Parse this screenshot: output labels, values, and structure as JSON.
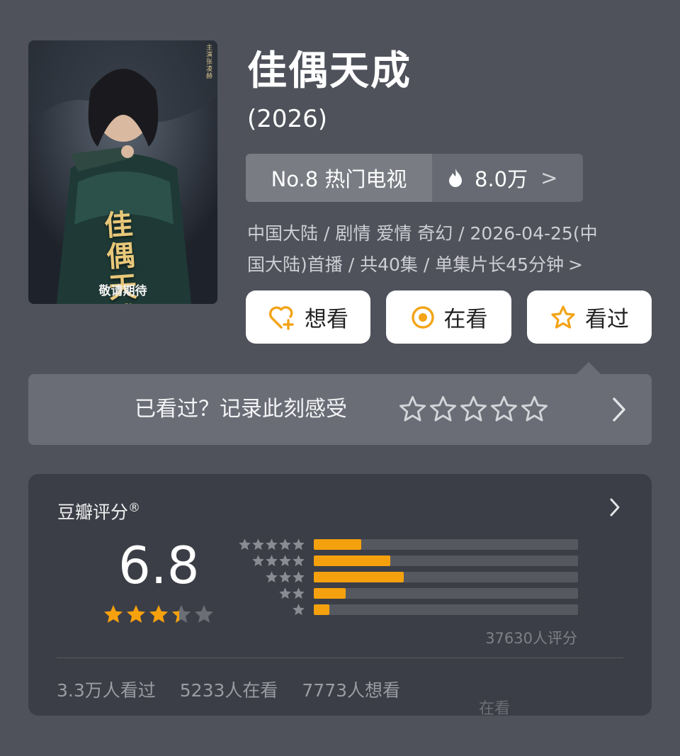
{
  "poster": {
    "calligraphy_title": "佳偶天成",
    "tagline": "敬请期待",
    "cast": "主演 张凌赫"
  },
  "header": {
    "title": "佳偶天成",
    "year": "(2026)"
  },
  "rank": {
    "label": "No.8 热门电视",
    "heat": "8.0万",
    "chevron": ">"
  },
  "meta": {
    "line1": "中国大陆 / 剧情 爱情 奇幻 / 2026-04-25(中",
    "line2": "国大陆)首播 / 共40集 / 单集片长45分钟",
    "chevron": ">"
  },
  "actions": {
    "want": {
      "label": "想看",
      "icon": "heart-plus-icon"
    },
    "watching": {
      "label": "在看",
      "icon": "target-icon"
    },
    "watched": {
      "label": "看过",
      "icon": "star-outline-icon"
    }
  },
  "prompt": {
    "text": "已看过？记录此刻感受",
    "star_count": 5
  },
  "rating": {
    "title": "豆瓣评分",
    "mark": "®",
    "score": "6.8",
    "stars_value": 3.4,
    "distribution": [
      {
        "stars": 5,
        "fraction": 0.18
      },
      {
        "stars": 4,
        "fraction": 0.29
      },
      {
        "stars": 3,
        "fraction": 0.34
      },
      {
        "stars": 2,
        "fraction": 0.12
      },
      {
        "stars": 1,
        "fraction": 0.06
      }
    ],
    "count_label": "37630人评分"
  },
  "stats": {
    "watched": "3.3万人看过",
    "watching": "5233人在看",
    "want": "7773人想看"
  },
  "watermark": "在看",
  "colors": {
    "background": "#4f525b",
    "card": "#3b3e46",
    "accent": "#f5a10e",
    "button_icon": "#f3a417"
  }
}
